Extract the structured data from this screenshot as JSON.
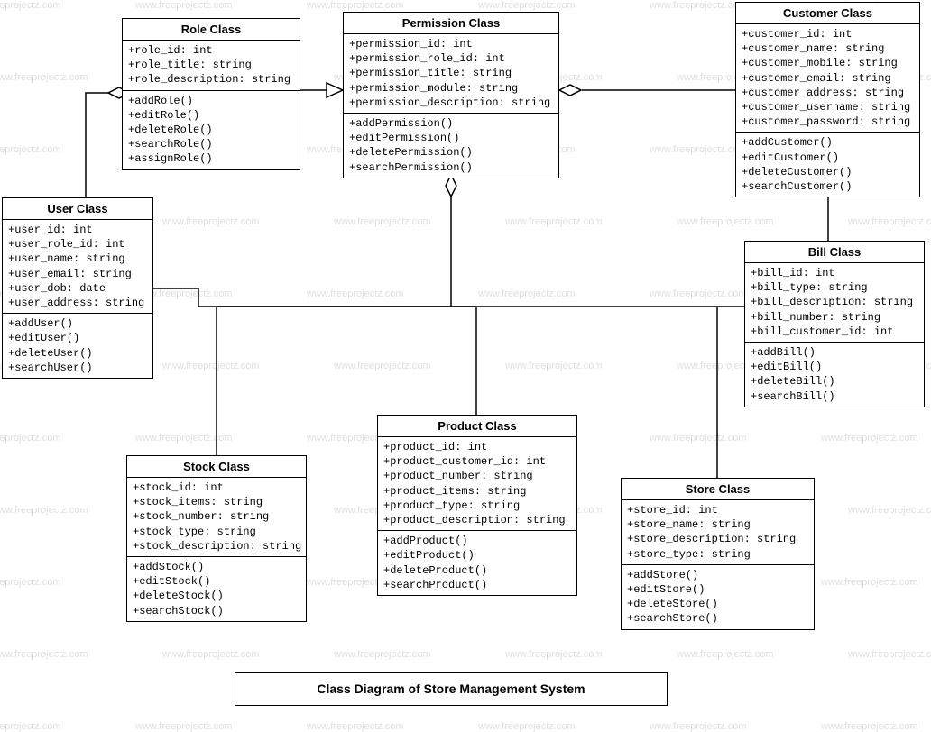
{
  "title": "Class Diagram of Store Management System",
  "watermark_text": "www.freeprojectz.com",
  "classes": {
    "role": {
      "name": "Role Class",
      "attributes": [
        "+role_id: int",
        "+role_title: string",
        "+role_description: string"
      ],
      "methods": [
        "+addRole()",
        "+editRole()",
        "+deleteRole()",
        "+searchRole()",
        "+assignRole()"
      ]
    },
    "permission": {
      "name": "Permission Class",
      "attributes": [
        "+permission_id: int",
        "+permission_role_id: int",
        "+permission_title: string",
        "+permission_module: string",
        "+permission_description: string"
      ],
      "methods": [
        "+addPermission()",
        "+editPermission()",
        "+deletePermission()",
        "+searchPermission()"
      ]
    },
    "customer": {
      "name": "Customer Class",
      "attributes": [
        "+customer_id: int",
        "+customer_name: string",
        "+customer_mobile: string",
        "+customer_email: string",
        "+customer_address: string",
        "+customer_username: string",
        "+customer_password: string"
      ],
      "methods": [
        "+addCustomer()",
        "+editCustomer()",
        "+deleteCustomer()",
        "+searchCustomer()"
      ]
    },
    "user": {
      "name": "User Class",
      "attributes": [
        "+user_id: int",
        "+user_role_id: int",
        "+user_name: string",
        "+user_email: string",
        "+user_dob: date",
        "+user_address: string"
      ],
      "methods": [
        "+addUser()",
        "+editUser()",
        "+deleteUser()",
        "+searchUser()"
      ]
    },
    "bill": {
      "name": "Bill Class",
      "attributes": [
        "+bill_id: int",
        "+bill_type: string",
        "+bill_description: string",
        "+bill_number: string",
        "+bill_customer_id: int"
      ],
      "methods": [
        "+addBill()",
        "+editBill()",
        "+deleteBill()",
        "+searchBill()"
      ]
    },
    "stock": {
      "name": "Stock Class",
      "attributes": [
        "+stock_id: int",
        "+stock_items: string",
        "+stock_number: string",
        "+stock_type: string",
        "+stock_description: string"
      ],
      "methods": [
        "+addStock()",
        "+editStock()",
        "+deleteStock()",
        "+searchStock()"
      ]
    },
    "product": {
      "name": "Product  Class",
      "attributes": [
        "+product_id: int",
        "+product_customer_id: int",
        "+product_number: string",
        "+product_items: string",
        "+product_type: string",
        "+product_description: string"
      ],
      "methods": [
        "+addProduct()",
        "+editProduct()",
        "+deleteProduct()",
        "+searchProduct()"
      ]
    },
    "store": {
      "name": "Store Class",
      "attributes": [
        "+store_id: int",
        "+store_name: string",
        "+store_description: string",
        "+store_type: string"
      ],
      "methods": [
        "+addStore()",
        "+editStore()",
        "+deleteStore()",
        "+searchStore()"
      ]
    }
  }
}
